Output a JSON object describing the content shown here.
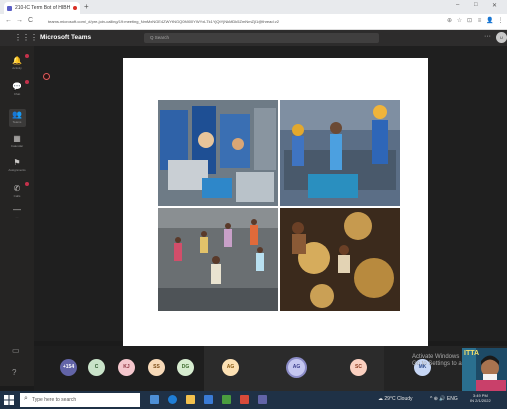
{
  "browser": {
    "tab_title": "210-IC Term Bot of HIBH",
    "new_tab": "+",
    "url": "teams.microsoft.com/_#/pre-join-calling/19:meeting_NmMxNGE4ZWYtNGQ0Mi00YWYxLTk1YjQtYjNkMDk5ZmNmZjI1@thread.v2",
    "window_controls": [
      "–",
      "□",
      "✕"
    ],
    "nav": [
      "←",
      "→",
      "C"
    ],
    "extensions": [
      "⊕",
      "☆",
      "⊡",
      "≡",
      "👤",
      "⋮"
    ]
  },
  "teams": {
    "app_grid_icon": "⋮⋮⋮",
    "title": "Microsoft Teams",
    "search_placeholder": "Q Search",
    "more_icon": "···",
    "profile_initials": "U"
  },
  "rail": [
    {
      "label": "Activity",
      "icon": "bell-icon",
      "glyph": "🔔",
      "badge": true
    },
    {
      "label": "Chat",
      "icon": "chat-icon",
      "glyph": "💬",
      "badge": true
    },
    {
      "label": "Teams",
      "icon": "teams-icon",
      "glyph": "👥",
      "badge": false
    },
    {
      "label": "Calendar",
      "icon": "calendar-icon",
      "glyph": "▦",
      "badge": false
    },
    {
      "label": "Assignments",
      "icon": "assignments-icon",
      "glyph": "⚑",
      "badge": false
    },
    {
      "label": "Calls",
      "icon": "calls-icon",
      "glyph": "✆",
      "badge": true
    },
    {
      "label": "···",
      "icon": "more-apps-icon",
      "glyph": "—",
      "badge": false
    }
  ],
  "rail_bottom": [
    {
      "icon": "apps-icon",
      "glyph": "▭"
    },
    {
      "icon": "help-icon",
      "glyph": "?"
    }
  ],
  "participants": [
    {
      "initials": "+154",
      "color": "#6264a7",
      "text": "#ffffff"
    },
    {
      "initials": "C",
      "color": "#c9e3c9",
      "text": "#2f5a2f"
    },
    {
      "initials": "KJ",
      "color": "#f4c6cc",
      "text": "#8a2f3b"
    },
    {
      "initials": "SS",
      "color": "#f7d9b8",
      "text": "#7a4a16"
    },
    {
      "initials": "DG",
      "color": "#d6eccf",
      "text": "#3d6b2f"
    },
    {
      "initials": "AG",
      "color": "#fde1b4",
      "text": "#8a5a12"
    },
    {
      "initials": "AG",
      "color": "#c5c7f0",
      "text": "#3b3e8c"
    },
    {
      "initials": "SC",
      "color": "#fbd0c0",
      "text": "#8c3b1e"
    },
    {
      "initials": "MK",
      "color": "#c7d7f5",
      "text": "#2f4d8c"
    }
  ],
  "watermark": {
    "line1": "Activate Windows",
    "line2": "Go to Settings to activate"
  },
  "video_label": "ITTA",
  "taskbar": {
    "search_placeholder": "Type here to search",
    "weather": "☁ 29°C Cloudy",
    "tray": "^ ⊕ 🔊 ENG",
    "time": "3:49 PM",
    "date": "IN  2/1/2022"
  }
}
